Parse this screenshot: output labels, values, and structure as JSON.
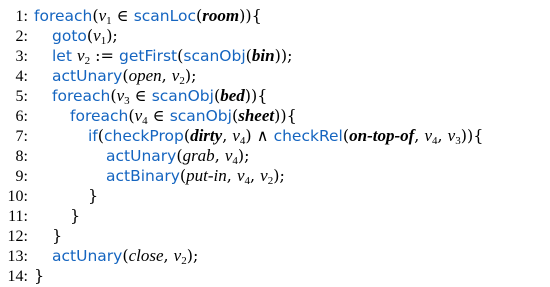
{
  "lines": [
    {
      "num": "1:"
    },
    {
      "num": "2:"
    },
    {
      "num": "3:"
    },
    {
      "num": "4:"
    },
    {
      "num": "5:"
    },
    {
      "num": "6:"
    },
    {
      "num": "7:"
    },
    {
      "num": "8:"
    },
    {
      "num": "9:"
    },
    {
      "num": "10:"
    },
    {
      "num": "11:"
    },
    {
      "num": "12:"
    },
    {
      "num": "13:"
    },
    {
      "num": "14:"
    }
  ],
  "kw": {
    "foreach": "foreach",
    "let": "let",
    "if": "if"
  },
  "fn": {
    "scanLoc": "scanLoc",
    "goto": "goto",
    "getFirst": "getFirst",
    "scanObj": "scanObj",
    "actUnary": "actUnary",
    "actBinary": "actBinary",
    "checkProp": "checkProp",
    "checkRel": "checkRel"
  },
  "vars": {
    "v": "v",
    "s1": "1",
    "s2": "2",
    "s3": "3",
    "s4": "4"
  },
  "args": {
    "room": "room",
    "bin": "bin",
    "open": "open",
    "bed": "bed",
    "sheet": "sheet",
    "dirty": "dirty",
    "on_top_of": "on-top-of",
    "grab": "grab",
    "put_in": "put-in",
    "close": "close"
  },
  "sym": {
    "in": "∈",
    "assign": ":=",
    "and": "∧"
  }
}
